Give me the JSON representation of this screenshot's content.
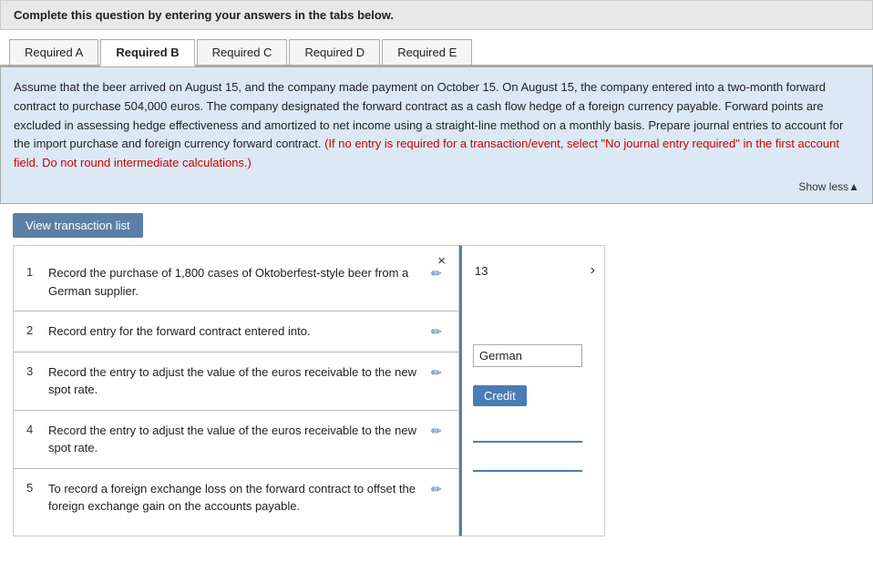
{
  "top_instruction": "Complete this question by entering your answers in the tabs below.",
  "tabs": [
    {
      "label": "Required A",
      "active": false
    },
    {
      "label": "Required B",
      "active": true
    },
    {
      "label": "Required C",
      "active": false
    },
    {
      "label": "Required D",
      "active": false
    },
    {
      "label": "Required E",
      "active": false
    }
  ],
  "scenario": {
    "main_text": "Assume that the beer arrived on August 15, and the company made payment on October 15. On August 15, the company entered into a two-month forward contract to purchase 504,000 euros. The company designated the forward contract as a cash flow hedge of a foreign currency payable. Forward points are excluded in assessing hedge effectiveness and amortized to net income using a straight-line method on a monthly basis. Prepare journal entries to account for the import purchase and foreign currency forward contract.",
    "red_text": "(If no entry is required for a transaction/event, select \"No journal entry required\" in the first account field. Do not round intermediate calculations.)",
    "show_less": "Show less▲"
  },
  "view_transaction_btn": "View transaction list",
  "close_btn": "×",
  "transactions": [
    {
      "num": "1",
      "desc": "Record the purchase of 1,800 cases of Oktoberfest-style beer from a German supplier."
    },
    {
      "num": "2",
      "desc": "Record entry for the forward contract entered into."
    },
    {
      "num": "3",
      "desc": "Record the entry to adjust the value of the euros receivable to the new spot rate."
    },
    {
      "num": "4",
      "desc": "Record the entry to adjust the value of the euros receivable to the new spot rate."
    },
    {
      "num": "5",
      "desc": "To record a foreign exchange loss on the forward contract to offset the foreign exchange gain on the accounts payable."
    }
  ],
  "right_panel": {
    "number": "13",
    "german_label": "German",
    "credit_label": "Credit"
  }
}
